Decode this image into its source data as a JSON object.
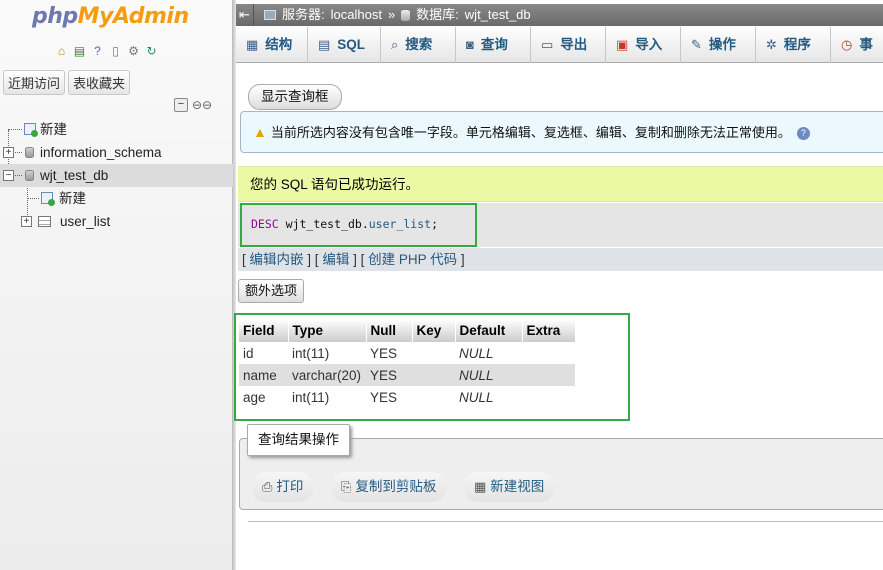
{
  "nav": {
    "logo_part1": "php",
    "logo_part2": "MyAdmin",
    "recent_label": "近期访问",
    "favorites_label": "表收藏夹",
    "tree": [
      {
        "label": "新建",
        "type": "new"
      },
      {
        "label": "information_schema",
        "type": "db"
      },
      {
        "label": "wjt_test_db",
        "type": "db"
      },
      {
        "label": "新建",
        "type": "new"
      },
      {
        "label": "user_list",
        "type": "table"
      }
    ]
  },
  "topbar": {
    "server_label": "服务器:",
    "server_value": "localhost",
    "separator": "»",
    "db_label": "数据库:",
    "db_value": "wjt_test_db"
  },
  "tabs": [
    {
      "label": "结构",
      "icon": "structure-icon"
    },
    {
      "label": "SQL",
      "icon": "sql-icon"
    },
    {
      "label": "搜索",
      "icon": "search-icon"
    },
    {
      "label": "查询",
      "icon": "query-icon"
    },
    {
      "label": "导出",
      "icon": "export-icon"
    },
    {
      "label": "导入",
      "icon": "import-icon"
    },
    {
      "label": "操作",
      "icon": "wrench-icon"
    },
    {
      "label": "程序",
      "icon": "routines-icon"
    },
    {
      "label": "事",
      "icon": "events-icon"
    }
  ],
  "main": {
    "show_query_box": "显示查询框",
    "notice": "当前所选内容没有包含唯一字段。单元格编辑、复选框、编辑、复制和删除无法正常使用。",
    "success": "您的 SQL 语句已成功运行。",
    "sql": {
      "keyword": "DESC",
      "db": "wjt_test_db",
      "dot": ".",
      "table": "user_list",
      "semicolon": ";"
    },
    "links": {
      "open": "[",
      "inline_edit": "编辑内嵌",
      "mid1": "] [",
      "edit": "编辑",
      "mid2": "] [",
      "create_php": "创建 PHP 代码",
      "close": "]"
    },
    "extra_options": "额外选项",
    "result": {
      "headers": [
        "Field",
        "Type",
        "Null",
        "Key",
        "Default",
        "Extra"
      ],
      "rows": [
        [
          "id",
          "int(11)",
          "YES",
          "",
          "NULL",
          ""
        ],
        [
          "name",
          "varchar(20)",
          "YES",
          "",
          "NULL",
          ""
        ],
        [
          "age",
          "int(11)",
          "YES",
          "",
          "NULL",
          ""
        ]
      ]
    },
    "ops": {
      "legend": "查询结果操作",
      "print": "打印",
      "copy": "复制到剪贴板",
      "create_view": "新建视图"
    }
  }
}
